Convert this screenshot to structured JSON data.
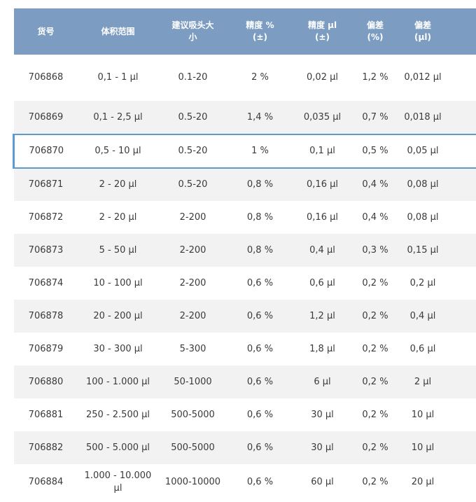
{
  "table": {
    "headers": [
      "货号",
      "体积范围",
      "建议吸头大\n小",
      "精度 %\n(±)",
      "精度 µl\n(±)",
      "偏差\n(%)",
      "偏差\n(µl)",
      ""
    ],
    "rows": [
      [
        "706868",
        "0,1 - 1 µl",
        "0.1-20",
        "2 %",
        "0,02 µl",
        "1,2 %",
        "0,012 µl",
        ""
      ],
      [
        "706869",
        "0,1 - 2,5 µl",
        "0.5-20",
        "1,4 %",
        "0,035 µl",
        "0,7 %",
        "0,018 µl",
        ""
      ],
      [
        "706870",
        "0,5 - 10 µl",
        "0.5-20",
        "1 %",
        "0,1 µl",
        "0,5 %",
        "0,05 µl",
        ""
      ],
      [
        "706871",
        "2 - 20 µl",
        "0.5-20",
        "0,8 %",
        "0,16 µl",
        "0,4 %",
        "0,08 µl",
        ""
      ],
      [
        "706872",
        "2 - 20 µl",
        "2-200",
        "0,8 %",
        "0,16 µl",
        "0,4 %",
        "0,08 µl",
        ""
      ],
      [
        "706873",
        "5 - 50 µl",
        "2-200",
        "0,8 %",
        "0,4 µl",
        "0,3 %",
        "0,15 µl",
        ""
      ],
      [
        "706874",
        "10 - 100 µl",
        "2-200",
        "0,6 %",
        "0,6 µl",
        "0,2 %",
        "0,2 µl",
        ""
      ],
      [
        "706878",
        "20 - 200 µl",
        "2-200",
        "0,6 %",
        "1,2 µl",
        "0,2 %",
        "0,4 µl",
        ""
      ],
      [
        "706879",
        "30 - 300 µl",
        "5-300",
        "0,6 %",
        "1,8 µl",
        "0,2 %",
        "0,6 µl",
        ""
      ],
      [
        "706880",
        "100 - 1.000 µl",
        "50-1000",
        "0,6 %",
        "6 µl",
        "0,2 %",
        "2 µl",
        ""
      ],
      [
        "706881",
        "250 - 2.500 µl",
        "500-5000",
        "0,6 %",
        "30 µl",
        "0,2 %",
        "10 µl",
        ""
      ],
      [
        "706882",
        "500 - 5.000 µl",
        "500-5000",
        "0,6 %",
        "30 µl",
        "0,2 %",
        "10 µl",
        ""
      ],
      [
        "706884",
        "1.000 - 10.000 µl",
        "1000-10000",
        "0,6 %",
        "60 µl",
        "0,2 %",
        "20 µl",
        ""
      ]
    ],
    "selected_row": 2
  },
  "colors": {
    "header_bg": "#7c9cc2",
    "header_text": "#ffffff",
    "stripe_bg": "#f2f2f2",
    "selection_border": "#5b9bd5"
  }
}
